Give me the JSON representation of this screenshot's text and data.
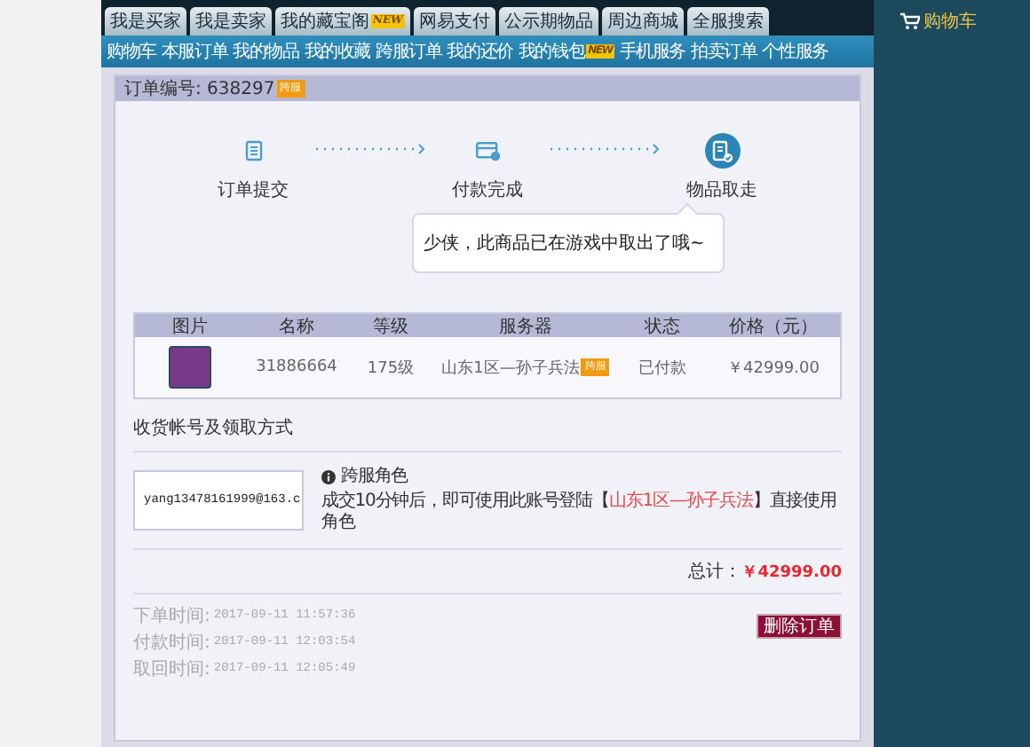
{
  "top_tabs": [
    {
      "label": "我是买家"
    },
    {
      "label": "我是卖家"
    },
    {
      "label": "我的藏宝阁",
      "badge": "NEW"
    },
    {
      "label": "网易支付"
    },
    {
      "label": "公示期物品"
    },
    {
      "label": "周边商城"
    },
    {
      "label": "全服搜索"
    }
  ],
  "cart": {
    "label": "购物车"
  },
  "sub_nav": [
    {
      "label": "购物车"
    },
    {
      "label": "本服订单"
    },
    {
      "label": "我的物品"
    },
    {
      "label": "我的收藏"
    },
    {
      "label": "跨服订单"
    },
    {
      "label": "我的还价"
    },
    {
      "label": "我的钱包",
      "badge": "NEW"
    },
    {
      "label": "手机服务"
    },
    {
      "label": "拍卖订单"
    },
    {
      "label": "个性服务"
    }
  ],
  "order": {
    "number_label": "订单编号: 638297",
    "badge": "跨服"
  },
  "steps": [
    {
      "label": "订单提交",
      "kind": "list",
      "current": false
    },
    {
      "label": "付款完成",
      "kind": "card",
      "current": false
    },
    {
      "label": "物品取走",
      "kind": "receipt",
      "current": true
    }
  ],
  "message": "少侠，此商品已在游戏中取出了哦~",
  "table": {
    "columns": [
      "图片",
      "名称",
      "等级",
      "服务器",
      "状态",
      "价格（元）"
    ],
    "rows": [
      {
        "name": "31886664",
        "level": "175级",
        "server": "山东1区—孙子兵法",
        "server_badge": "跨服",
        "status": "已付款",
        "price": "￥42999.00"
      }
    ]
  },
  "delivery": {
    "title": "收货帐号及领取方式",
    "account": "yang13478161999@163.c",
    "note_title": "跨服角色",
    "note_before": "成交10分钟后，即可使用此账号登陆【",
    "note_link": "山东1区—孙子兵法",
    "note_after": "】直接使用角色"
  },
  "total": {
    "label": "总计：",
    "value": "￥42999.00"
  },
  "times": [
    {
      "label": "下单时间:",
      "value": "2017-09-11 11:57:36"
    },
    {
      "label": "付款时间:",
      "value": "2017-09-11 12:03:54"
    },
    {
      "label": "取回时间:",
      "value": "2017-09-11 12:05:49"
    }
  ],
  "delete_button": "删除订单"
}
